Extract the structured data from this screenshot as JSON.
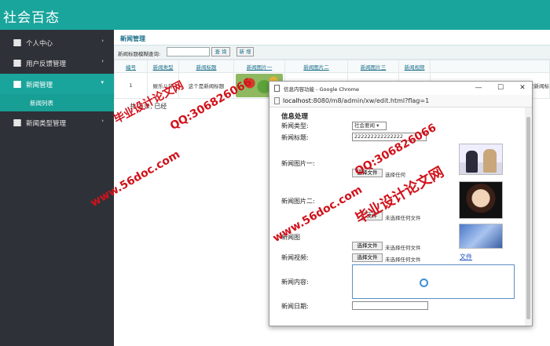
{
  "app": {
    "title": "社会百态"
  },
  "sidebar": {
    "items": [
      {
        "label": "个人中心",
        "arrow": "›"
      },
      {
        "label": "用户反馈管理",
        "arrow": "›"
      },
      {
        "label": "新闻管理",
        "arrow": "▾"
      },
      {
        "label": "新闻类型管理",
        "arrow": "›"
      }
    ],
    "sub_item": "新闻列表"
  },
  "main": {
    "section_title": "新闻管理",
    "search": {
      "label": "新闻标题模糊查询:",
      "value": "",
      "search_btn": "查 询",
      "add_btn": "新 增"
    },
    "table": {
      "headers": [
        "编号",
        "新闻类型",
        "新闻标题",
        "新闻图片一",
        "新闻图片二",
        "新闻图片三",
        "新闻视频"
      ],
      "rows": [
        {
          "id": "1",
          "type": "娱乐八卦",
          "title": "这个是新闻标题"
        }
      ],
      "overflow_text": "个是新闻标"
    },
    "pager": "共 1 条, 已经"
  },
  "popup": {
    "window_title": "信息内容功能 - Google Chrome",
    "url_host": "localhost",
    "url_path": ":8080/m8/admin/xw/edit.html?flag=1",
    "minimize": "—",
    "maximize": "☐",
    "close": "✕",
    "form": {
      "title": "信息处理",
      "type_label": "新闻类型:",
      "type_value": "社会要闻 ▾",
      "title_label": "新闻标题:",
      "title_value": "222222222222222",
      "image1_label": "新闻图片一:",
      "image2_label": "新闻图片二:",
      "image3_label": "新闻图",
      "video_label": "新闻视频:",
      "content_label": "新闻内容:",
      "date_label": "新闻日期:",
      "file_btn": "选择文件",
      "file_btn_partial": "文件",
      "no_file": "未选择任何文件",
      "no_file_partial": "选择任何",
      "file_link": "文件",
      "content_value": "",
      "date_value": ""
    }
  },
  "watermarks": {
    "site": "www.56doc.com",
    "qq": "QQ:306826066",
    "brand": "毕业设计论文网"
  },
  "colors": {
    "accent": "#1aa59c",
    "sidebar_bg": "#2f3138",
    "watermark": "#d1121b"
  }
}
